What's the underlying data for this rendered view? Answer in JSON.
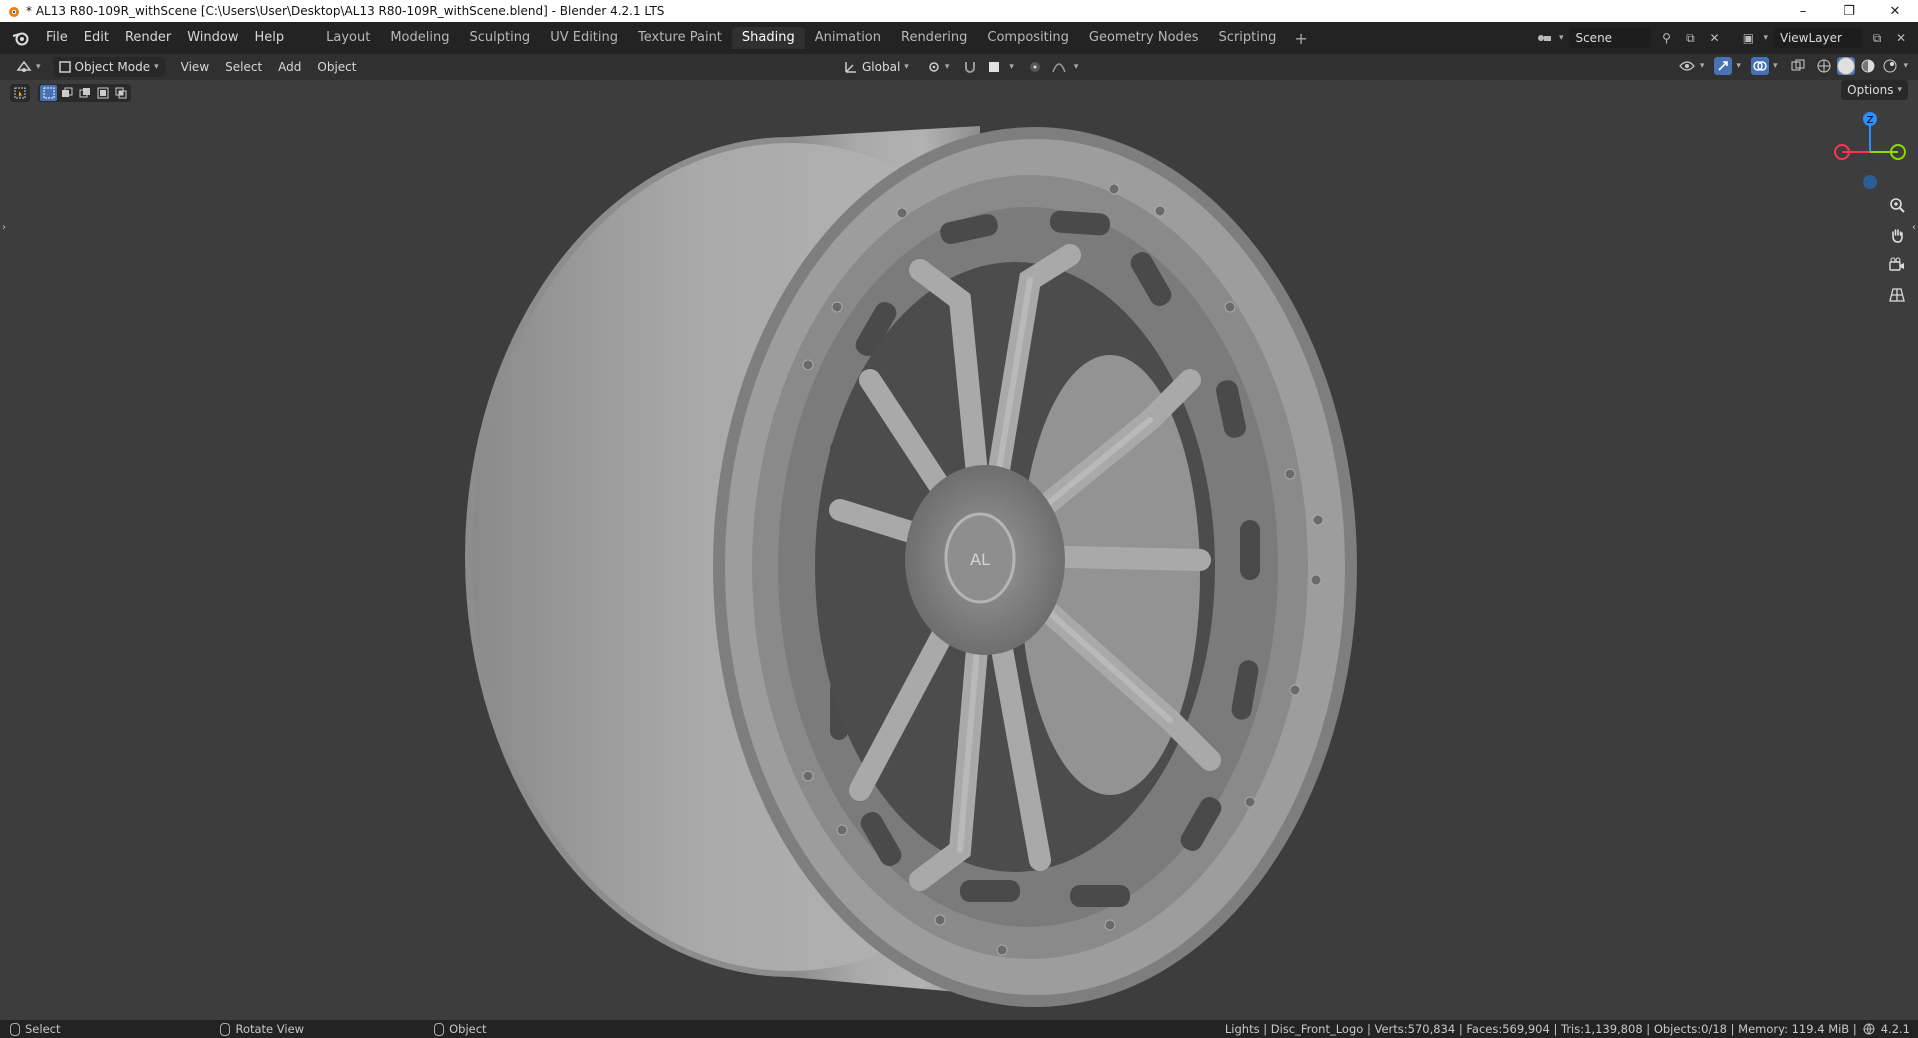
{
  "window": {
    "title": "* AL13 R80-109R_withScene [C:\\Users\\User\\Desktop\\AL13 R80-109R_withScene.blend] - Blender 4.2.1 LTS",
    "minimize": "–",
    "restore": "❐",
    "close": "✕"
  },
  "menu": {
    "items": [
      "File",
      "Edit",
      "Render",
      "Window",
      "Help"
    ]
  },
  "workspaces": {
    "tabs": [
      "Layout",
      "Modeling",
      "Sculpting",
      "UV Editing",
      "Texture Paint",
      "Shading",
      "Animation",
      "Rendering",
      "Compositing",
      "Geometry Nodes",
      "Scripting"
    ],
    "active": "Shading",
    "add_label": "+"
  },
  "scene": {
    "name": "Scene"
  },
  "view_layer": {
    "name": "ViewLayer"
  },
  "viewport_header": {
    "mode": "Object Mode",
    "menus": [
      "View",
      "Select",
      "Add",
      "Object"
    ],
    "transform_orientation": "Global"
  },
  "options_label": "Options",
  "gizmo": {
    "z_label": "Z"
  },
  "statusbar": {
    "select": "Select",
    "rotate": "Rotate View",
    "object": "Object",
    "stats": "Lights | Disc_Front_Logo | Verts:570,834 | Faces:569,904 | Tris:1,139,808 | Objects:0/18 | Memory: 119.4 MiB |",
    "version": "4.2.1"
  },
  "colors": {
    "accent": "#4772b3",
    "viewport_bg": "#3d3d3d",
    "axis_x": "#ff3352",
    "axis_y": "#8bdc00",
    "axis_z": "#2890ff"
  }
}
